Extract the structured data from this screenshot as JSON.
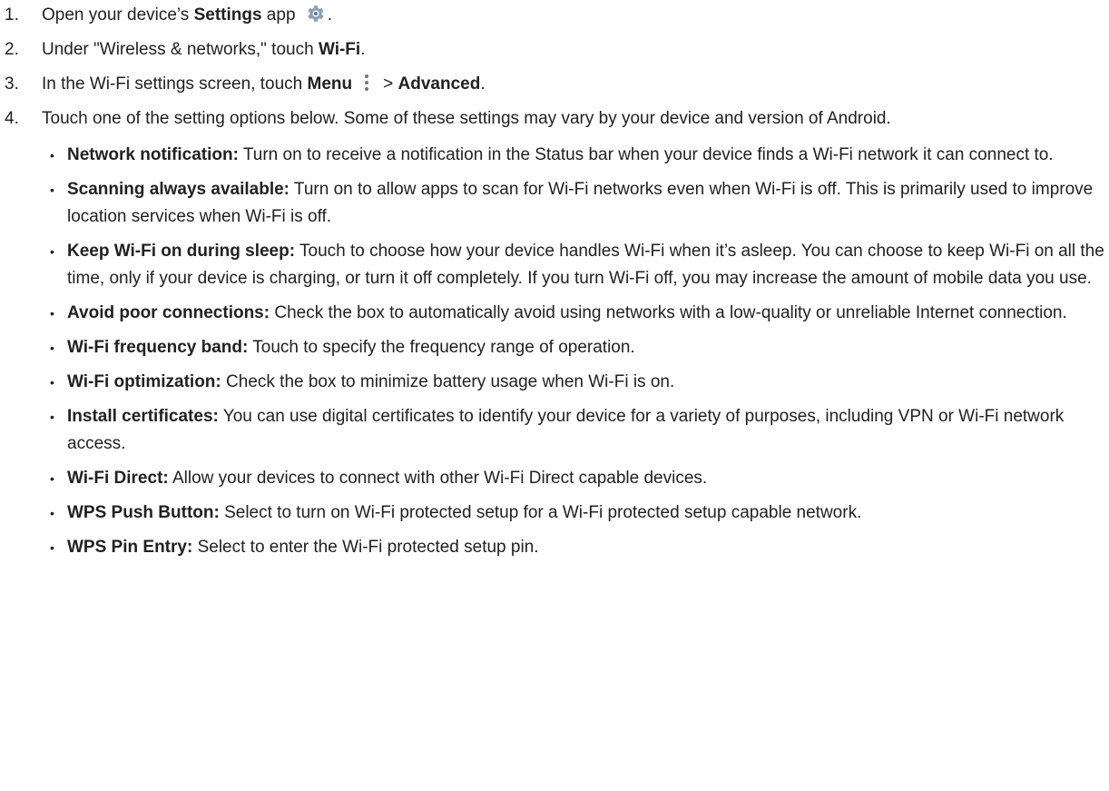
{
  "steps": [
    {
      "num": "1.",
      "pre": "Open your device’s ",
      "bold": "Settings",
      "post": " app",
      "after_icon": ".",
      "icon": "settings-gear-icon"
    },
    {
      "num": "2.",
      "pre": "Under \"Wireless & networks,\" touch ",
      "bold": "Wi-Fi",
      "post": "."
    },
    {
      "num": "3.",
      "pre": "In the Wi-Fi settings screen, touch ",
      "bold": "Menu",
      "icon": "more-vert-icon",
      "mid": "> ",
      "bold2": "Advanced",
      "post": "."
    },
    {
      "num": "4.",
      "text": "Touch one of the setting options below. Some of these settings may vary by your device and version of Android."
    }
  ],
  "options": [
    {
      "title": "Network notification:",
      "desc": " Turn on to receive a notification in the Status bar when your device finds a Wi-Fi network it can connect to."
    },
    {
      "title": "Scanning always available:",
      "desc": " Turn on to allow apps to scan for Wi-Fi networks even when Wi-Fi is off. This is primarily used to improve location services when Wi-Fi is off."
    },
    {
      "title": "Keep Wi-Fi on during sleep:",
      "desc": " Touch to choose how your device handles Wi-Fi when it’s asleep. You can choose to keep Wi-Fi on all the time, only if your device is charging, or turn it off completely. If you turn Wi-Fi off, you may increase the amount of mobile data you use."
    },
    {
      "title": "Avoid poor connections:",
      "desc": " Check the box to automatically avoid using networks with a low-quality or unreliable Internet connection."
    },
    {
      "title": "Wi-Fi frequency band:",
      "desc": " Touch to specify the frequency range of operation."
    },
    {
      "title": "Wi-Fi optimization:",
      "desc": " Check the box to minimize battery usage when Wi-Fi is on."
    },
    {
      "title": "Install certificates:",
      "desc": " You can use digital certificates to identify your device for a variety of purposes, including VPN or Wi-Fi network access."
    },
    {
      "title": "Wi-Fi Direct:",
      "desc": " Allow your devices to connect with other Wi-Fi Direct capable devices."
    },
    {
      "title": "WPS Push Button:",
      "desc": " Select to turn on Wi-Fi protected setup for a Wi-Fi protected setup capable network."
    },
    {
      "title": "WPS Pin Entry:",
      "desc": " Select to enter the Wi-Fi protected setup pin."
    }
  ],
  "colors": {
    "text": "#212121",
    "gear_icon": "#8aa0b4",
    "menu_icon": "#757575"
  }
}
